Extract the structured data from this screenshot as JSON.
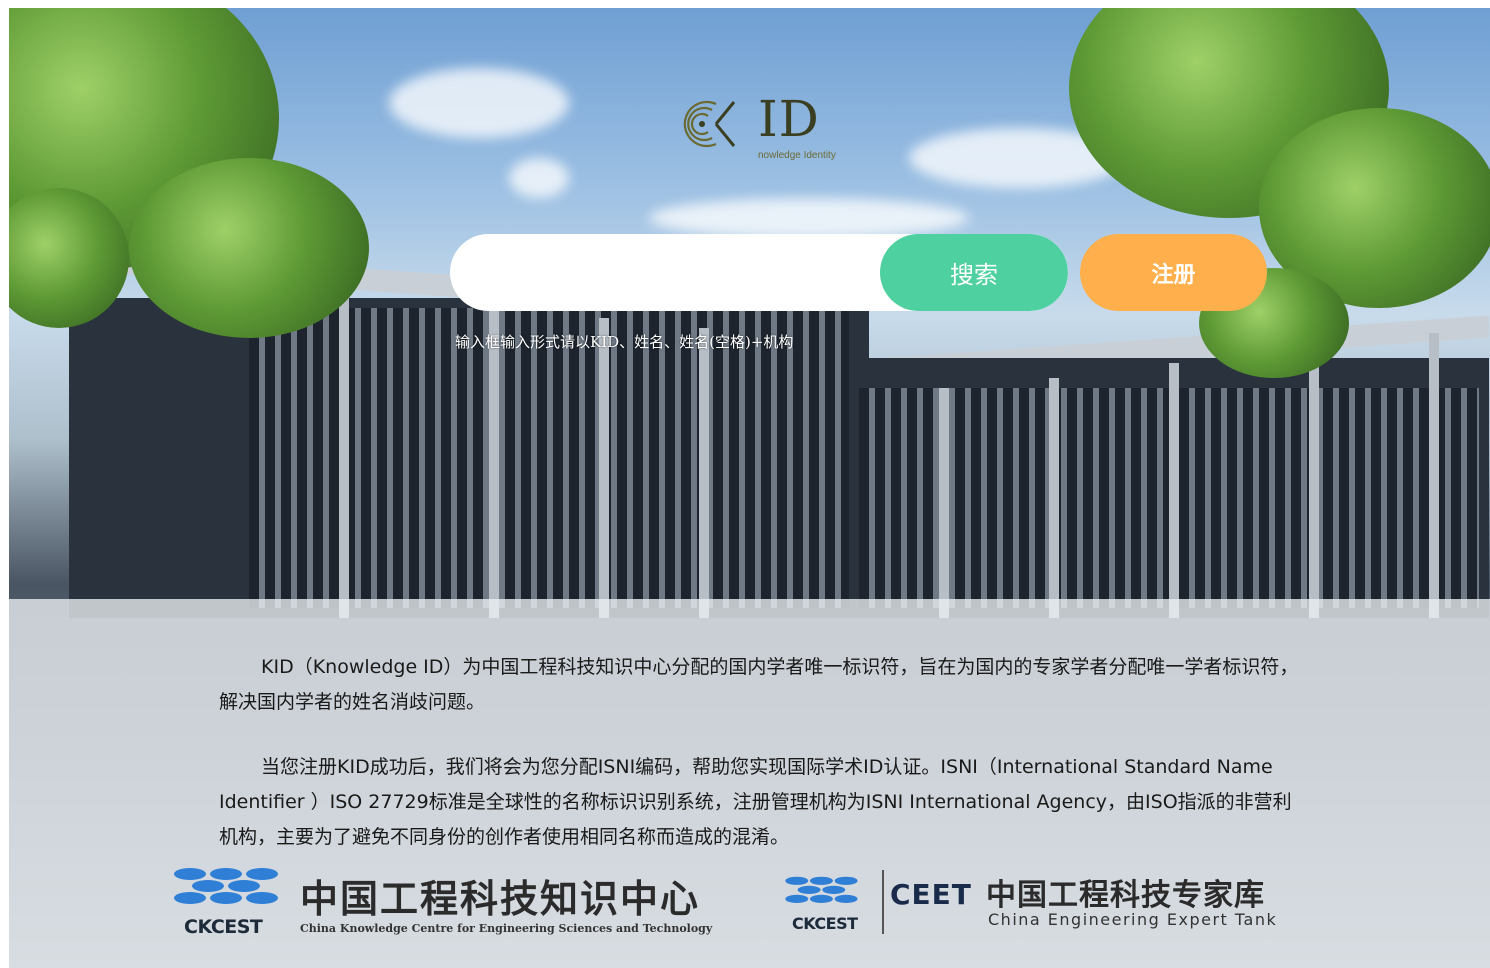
{
  "brand": {
    "logo_text": "ID",
    "logo_sub": "nowledge Identity"
  },
  "search": {
    "placeholder": "",
    "value": "",
    "button_label": "搜索"
  },
  "register": {
    "button_label": "注册"
  },
  "hint": "输入框输入形式请以KID、姓名、姓名(空格)+机构",
  "intro": {
    "paragraph_1": "KID（Knowledge ID）为中国工程科技知识中心分配的国内学者唯一标识符，旨在为国内的专家学者分配唯一学者标识符，解决国内学者的姓名消歧问题。",
    "paragraph_2": "当您注册KID成功后，我们将会为您分配ISNI编码，帮助您实现国际学术ID认证。ISNI（International Standard Name Identifier ）ISO 27729标准是全球性的名称标识识别系统，注册管理机构为ISNI International Agency，由ISO指派的非营利机构，主要为了避免不同身份的创作者使用相同名称而造成的混淆。"
  },
  "partners": {
    "ckcest": {
      "abbr": "CKCEST",
      "name_cn": "中国工程科技知识中心",
      "name_en": "China Knowledge Centre for Engineering Sciences and Technology"
    },
    "ceet": {
      "abbr": "CKCEST",
      "mark": "CEET",
      "name_cn": "中国工程科技专家库",
      "name_en": "China Engineering Expert Tank"
    }
  },
  "colors": {
    "search_button": "#4fd0a0",
    "register_button": "#ffb04c",
    "logo": "#3b3f22"
  },
  "icons": {
    "logo_emblem": "kid-logo-icon",
    "ckcest_emblem": "ckcest-emblem-icon",
    "ceet_emblem": "ckcest-emblem-icon"
  }
}
